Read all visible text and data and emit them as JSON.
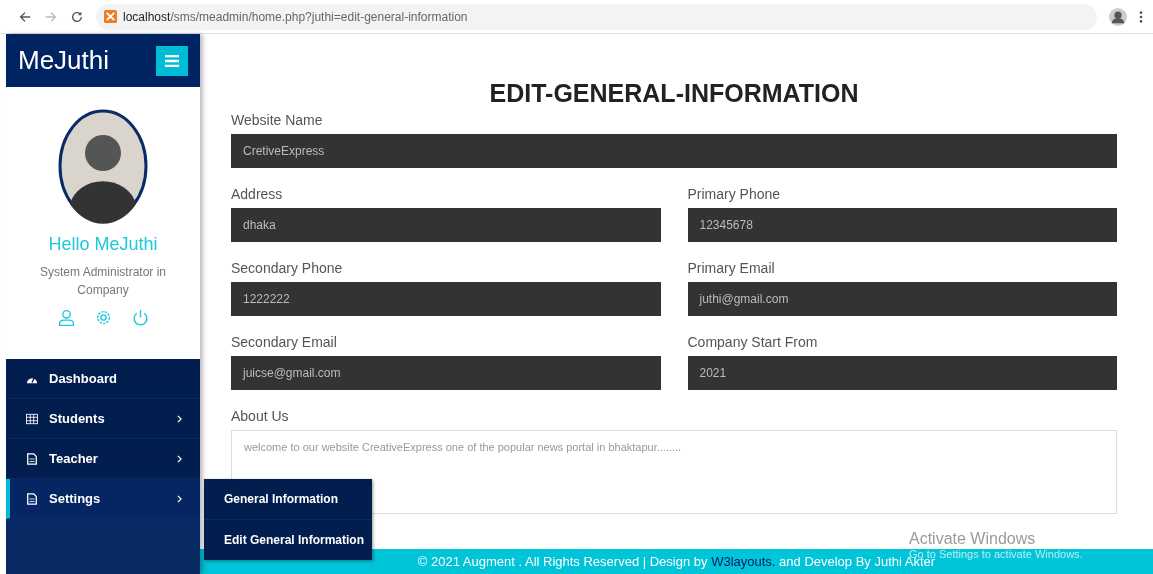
{
  "browser": {
    "url_host": "localhost",
    "url_path": "/sms/meadmin/home.php?juthi=edit-general-information"
  },
  "sidebar": {
    "brand": "MeJuthi",
    "greeting": "Hello MeJuthi",
    "role": "System Administrator in Company",
    "menu": [
      {
        "label": "Dashboard",
        "has_submenu": false,
        "selected": false
      },
      {
        "label": "Students",
        "has_submenu": true,
        "selected": false
      },
      {
        "label": "Teacher",
        "has_submenu": true,
        "selected": false
      },
      {
        "label": "Settings",
        "has_submenu": true,
        "selected": true
      }
    ],
    "submenu": [
      "General Information",
      "Edit General Information"
    ]
  },
  "page_title": "EDIT-GENERAL-INFORMATION",
  "form": {
    "fields": [
      {
        "label": "Website Name",
        "value": "CretiveExpress",
        "kind": "wide"
      },
      {
        "label": "Address",
        "value": "dhaka",
        "kind": "half"
      },
      {
        "label": "Primary Phone",
        "value": "12345678",
        "kind": "half"
      },
      {
        "label": "Secondary Phone",
        "value": "1222222",
        "kind": "half"
      },
      {
        "label": "Primary Email",
        "value": "juthi@gmail.com",
        "kind": "half"
      },
      {
        "label": "Secondary Email",
        "value": "juicse@gmail.com",
        "kind": "half"
      },
      {
        "label": "Company Start From",
        "value": "2021",
        "kind": "half"
      },
      {
        "label": "About Us",
        "value": "welcome to our website CreativeExpress one of the popular news portal in bhaktapur........",
        "kind": "textarea"
      }
    ]
  },
  "footer": {
    "text_before": "© 2021 Augment . All Rights Reserved | Design by",
    "link": "W3layouts.",
    "text_after": "and Develop By Juthi Akter"
  },
  "os_notice": {
    "title": "Activate Windows",
    "subtitle": "Go to Settings to activate Windows."
  }
}
